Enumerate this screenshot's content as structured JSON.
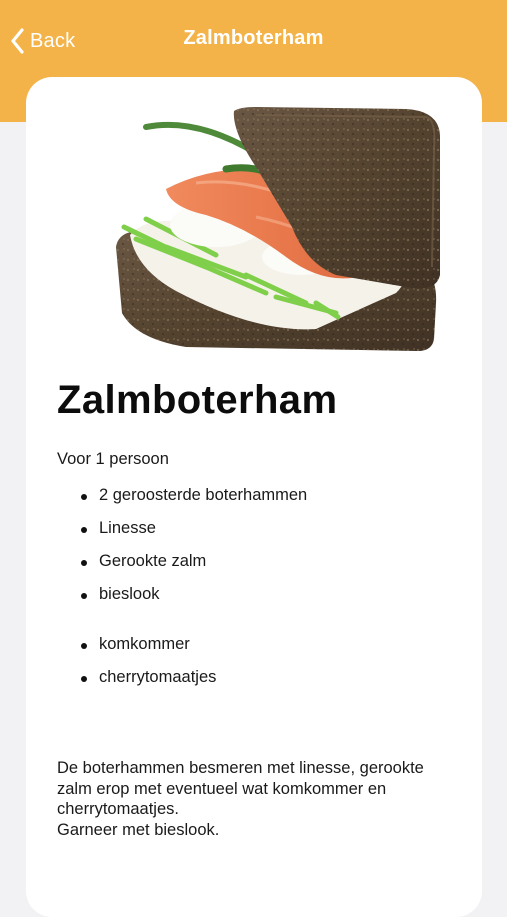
{
  "nav": {
    "back_label": "Back",
    "title": "Zalmboterham",
    "background": "#f4b349"
  },
  "recipe": {
    "image_icon": "salmon-sandwich-photo",
    "title": "Zalmboterham",
    "servings": "Voor 1 persoon",
    "ingredients": [
      "2 geroosterde boterhammen",
      "Linesse",
      "Gerookte zalm",
      "bieslook",
      "komkommer",
      "cherrytomaatjes"
    ],
    "instructions": [
      "De boterhammen besmeren met linesse, gerookte zalm erop met eventueel wat komkommer en cherrytomaatjes.",
      "Garneer met bieslook."
    ]
  }
}
